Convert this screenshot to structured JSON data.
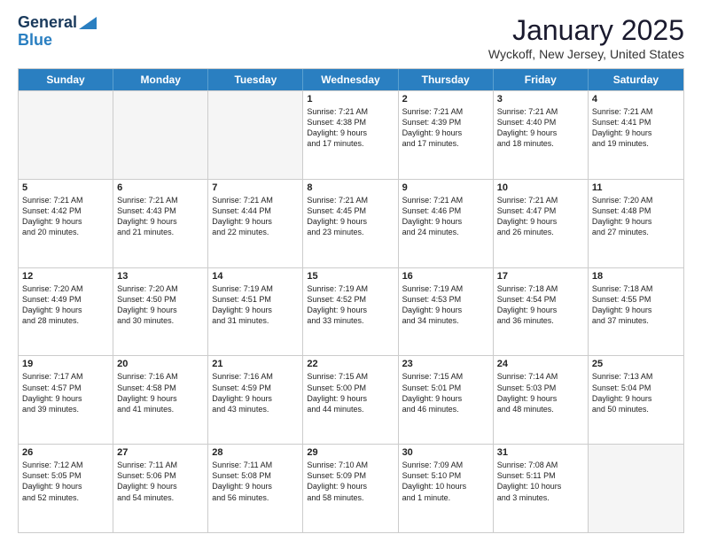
{
  "header": {
    "logo_line1": "General",
    "logo_line2": "Blue",
    "month": "January 2025",
    "location": "Wyckoff, New Jersey, United States"
  },
  "days": [
    "Sunday",
    "Monday",
    "Tuesday",
    "Wednesday",
    "Thursday",
    "Friday",
    "Saturday"
  ],
  "weeks": [
    [
      {
        "day": "",
        "text": ""
      },
      {
        "day": "",
        "text": ""
      },
      {
        "day": "",
        "text": ""
      },
      {
        "day": "1",
        "text": "Sunrise: 7:21 AM\nSunset: 4:38 PM\nDaylight: 9 hours\nand 17 minutes."
      },
      {
        "day": "2",
        "text": "Sunrise: 7:21 AM\nSunset: 4:39 PM\nDaylight: 9 hours\nand 17 minutes."
      },
      {
        "day": "3",
        "text": "Sunrise: 7:21 AM\nSunset: 4:40 PM\nDaylight: 9 hours\nand 18 minutes."
      },
      {
        "day": "4",
        "text": "Sunrise: 7:21 AM\nSunset: 4:41 PM\nDaylight: 9 hours\nand 19 minutes."
      }
    ],
    [
      {
        "day": "5",
        "text": "Sunrise: 7:21 AM\nSunset: 4:42 PM\nDaylight: 9 hours\nand 20 minutes."
      },
      {
        "day": "6",
        "text": "Sunrise: 7:21 AM\nSunset: 4:43 PM\nDaylight: 9 hours\nand 21 minutes."
      },
      {
        "day": "7",
        "text": "Sunrise: 7:21 AM\nSunset: 4:44 PM\nDaylight: 9 hours\nand 22 minutes."
      },
      {
        "day": "8",
        "text": "Sunrise: 7:21 AM\nSunset: 4:45 PM\nDaylight: 9 hours\nand 23 minutes."
      },
      {
        "day": "9",
        "text": "Sunrise: 7:21 AM\nSunset: 4:46 PM\nDaylight: 9 hours\nand 24 minutes."
      },
      {
        "day": "10",
        "text": "Sunrise: 7:21 AM\nSunset: 4:47 PM\nDaylight: 9 hours\nand 26 minutes."
      },
      {
        "day": "11",
        "text": "Sunrise: 7:20 AM\nSunset: 4:48 PM\nDaylight: 9 hours\nand 27 minutes."
      }
    ],
    [
      {
        "day": "12",
        "text": "Sunrise: 7:20 AM\nSunset: 4:49 PM\nDaylight: 9 hours\nand 28 minutes."
      },
      {
        "day": "13",
        "text": "Sunrise: 7:20 AM\nSunset: 4:50 PM\nDaylight: 9 hours\nand 30 minutes."
      },
      {
        "day": "14",
        "text": "Sunrise: 7:19 AM\nSunset: 4:51 PM\nDaylight: 9 hours\nand 31 minutes."
      },
      {
        "day": "15",
        "text": "Sunrise: 7:19 AM\nSunset: 4:52 PM\nDaylight: 9 hours\nand 33 minutes."
      },
      {
        "day": "16",
        "text": "Sunrise: 7:19 AM\nSunset: 4:53 PM\nDaylight: 9 hours\nand 34 minutes."
      },
      {
        "day": "17",
        "text": "Sunrise: 7:18 AM\nSunset: 4:54 PM\nDaylight: 9 hours\nand 36 minutes."
      },
      {
        "day": "18",
        "text": "Sunrise: 7:18 AM\nSunset: 4:55 PM\nDaylight: 9 hours\nand 37 minutes."
      }
    ],
    [
      {
        "day": "19",
        "text": "Sunrise: 7:17 AM\nSunset: 4:57 PM\nDaylight: 9 hours\nand 39 minutes."
      },
      {
        "day": "20",
        "text": "Sunrise: 7:16 AM\nSunset: 4:58 PM\nDaylight: 9 hours\nand 41 minutes."
      },
      {
        "day": "21",
        "text": "Sunrise: 7:16 AM\nSunset: 4:59 PM\nDaylight: 9 hours\nand 43 minutes."
      },
      {
        "day": "22",
        "text": "Sunrise: 7:15 AM\nSunset: 5:00 PM\nDaylight: 9 hours\nand 44 minutes."
      },
      {
        "day": "23",
        "text": "Sunrise: 7:15 AM\nSunset: 5:01 PM\nDaylight: 9 hours\nand 46 minutes."
      },
      {
        "day": "24",
        "text": "Sunrise: 7:14 AM\nSunset: 5:03 PM\nDaylight: 9 hours\nand 48 minutes."
      },
      {
        "day": "25",
        "text": "Sunrise: 7:13 AM\nSunset: 5:04 PM\nDaylight: 9 hours\nand 50 minutes."
      }
    ],
    [
      {
        "day": "26",
        "text": "Sunrise: 7:12 AM\nSunset: 5:05 PM\nDaylight: 9 hours\nand 52 minutes."
      },
      {
        "day": "27",
        "text": "Sunrise: 7:11 AM\nSunset: 5:06 PM\nDaylight: 9 hours\nand 54 minutes."
      },
      {
        "day": "28",
        "text": "Sunrise: 7:11 AM\nSunset: 5:08 PM\nDaylight: 9 hours\nand 56 minutes."
      },
      {
        "day": "29",
        "text": "Sunrise: 7:10 AM\nSunset: 5:09 PM\nDaylight: 9 hours\nand 58 minutes."
      },
      {
        "day": "30",
        "text": "Sunrise: 7:09 AM\nSunset: 5:10 PM\nDaylight: 10 hours\nand 1 minute."
      },
      {
        "day": "31",
        "text": "Sunrise: 7:08 AM\nSunset: 5:11 PM\nDaylight: 10 hours\nand 3 minutes."
      },
      {
        "day": "",
        "text": ""
      }
    ]
  ]
}
